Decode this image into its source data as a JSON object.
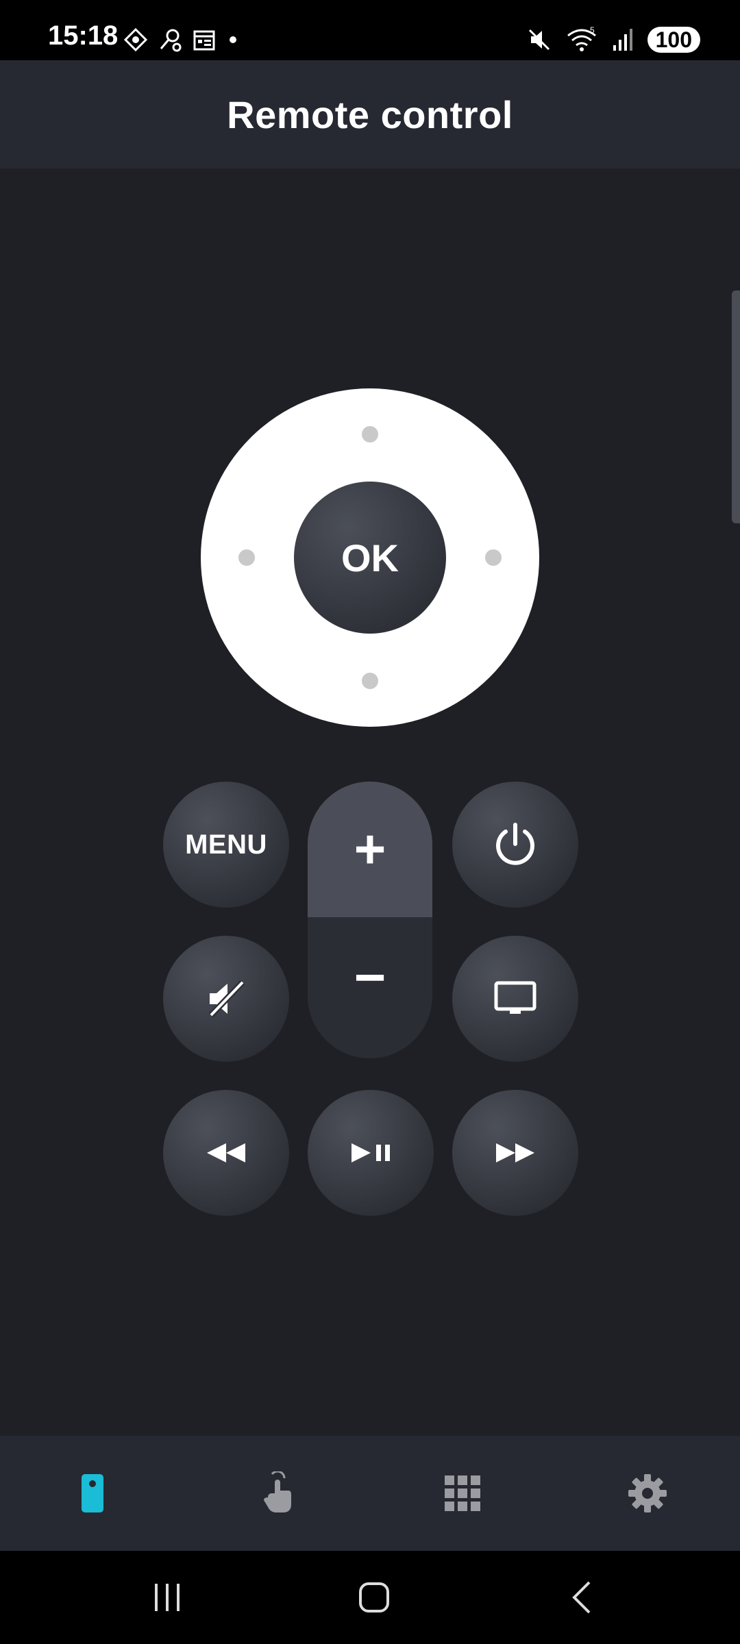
{
  "status_bar": {
    "time": "15:18",
    "battery": "100",
    "network_label": "5"
  },
  "header": {
    "title": "Remote control"
  },
  "remote": {
    "ok_label": "OK",
    "menu_label": "MENU",
    "volume_up_label": "+",
    "volume_down_label": "−"
  },
  "bottom_nav": {
    "items": [
      {
        "icon": "remote-icon",
        "active": true
      },
      {
        "icon": "touchpad-icon",
        "active": false
      },
      {
        "icon": "apps-grid-icon",
        "active": false
      },
      {
        "icon": "settings-icon",
        "active": false
      }
    ]
  },
  "colors": {
    "background": "#1f2025",
    "header_bg": "#262931",
    "accent": "#1bbcd6",
    "icon_inactive": "#9a9ca1"
  }
}
